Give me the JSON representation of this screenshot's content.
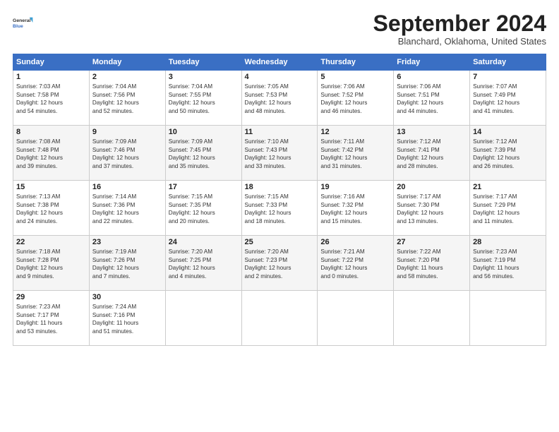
{
  "header": {
    "logo_line1": "General",
    "logo_line2": "Blue",
    "month": "September 2024",
    "location": "Blanchard, Oklahoma, United States"
  },
  "weekdays": [
    "Sunday",
    "Monday",
    "Tuesday",
    "Wednesday",
    "Thursday",
    "Friday",
    "Saturday"
  ],
  "weeks": [
    [
      {
        "day": "1",
        "info": "Sunrise: 7:03 AM\nSunset: 7:58 PM\nDaylight: 12 hours\nand 54 minutes."
      },
      {
        "day": "2",
        "info": "Sunrise: 7:04 AM\nSunset: 7:56 PM\nDaylight: 12 hours\nand 52 minutes."
      },
      {
        "day": "3",
        "info": "Sunrise: 7:04 AM\nSunset: 7:55 PM\nDaylight: 12 hours\nand 50 minutes."
      },
      {
        "day": "4",
        "info": "Sunrise: 7:05 AM\nSunset: 7:53 PM\nDaylight: 12 hours\nand 48 minutes."
      },
      {
        "day": "5",
        "info": "Sunrise: 7:06 AM\nSunset: 7:52 PM\nDaylight: 12 hours\nand 46 minutes."
      },
      {
        "day": "6",
        "info": "Sunrise: 7:06 AM\nSunset: 7:51 PM\nDaylight: 12 hours\nand 44 minutes."
      },
      {
        "day": "7",
        "info": "Sunrise: 7:07 AM\nSunset: 7:49 PM\nDaylight: 12 hours\nand 41 minutes."
      }
    ],
    [
      {
        "day": "8",
        "info": "Sunrise: 7:08 AM\nSunset: 7:48 PM\nDaylight: 12 hours\nand 39 minutes."
      },
      {
        "day": "9",
        "info": "Sunrise: 7:09 AM\nSunset: 7:46 PM\nDaylight: 12 hours\nand 37 minutes."
      },
      {
        "day": "10",
        "info": "Sunrise: 7:09 AM\nSunset: 7:45 PM\nDaylight: 12 hours\nand 35 minutes."
      },
      {
        "day": "11",
        "info": "Sunrise: 7:10 AM\nSunset: 7:43 PM\nDaylight: 12 hours\nand 33 minutes."
      },
      {
        "day": "12",
        "info": "Sunrise: 7:11 AM\nSunset: 7:42 PM\nDaylight: 12 hours\nand 31 minutes."
      },
      {
        "day": "13",
        "info": "Sunrise: 7:12 AM\nSunset: 7:41 PM\nDaylight: 12 hours\nand 28 minutes."
      },
      {
        "day": "14",
        "info": "Sunrise: 7:12 AM\nSunset: 7:39 PM\nDaylight: 12 hours\nand 26 minutes."
      }
    ],
    [
      {
        "day": "15",
        "info": "Sunrise: 7:13 AM\nSunset: 7:38 PM\nDaylight: 12 hours\nand 24 minutes."
      },
      {
        "day": "16",
        "info": "Sunrise: 7:14 AM\nSunset: 7:36 PM\nDaylight: 12 hours\nand 22 minutes."
      },
      {
        "day": "17",
        "info": "Sunrise: 7:15 AM\nSunset: 7:35 PM\nDaylight: 12 hours\nand 20 minutes."
      },
      {
        "day": "18",
        "info": "Sunrise: 7:15 AM\nSunset: 7:33 PM\nDaylight: 12 hours\nand 18 minutes."
      },
      {
        "day": "19",
        "info": "Sunrise: 7:16 AM\nSunset: 7:32 PM\nDaylight: 12 hours\nand 15 minutes."
      },
      {
        "day": "20",
        "info": "Sunrise: 7:17 AM\nSunset: 7:30 PM\nDaylight: 12 hours\nand 13 minutes."
      },
      {
        "day": "21",
        "info": "Sunrise: 7:17 AM\nSunset: 7:29 PM\nDaylight: 12 hours\nand 11 minutes."
      }
    ],
    [
      {
        "day": "22",
        "info": "Sunrise: 7:18 AM\nSunset: 7:28 PM\nDaylight: 12 hours\nand 9 minutes."
      },
      {
        "day": "23",
        "info": "Sunrise: 7:19 AM\nSunset: 7:26 PM\nDaylight: 12 hours\nand 7 minutes."
      },
      {
        "day": "24",
        "info": "Sunrise: 7:20 AM\nSunset: 7:25 PM\nDaylight: 12 hours\nand 4 minutes."
      },
      {
        "day": "25",
        "info": "Sunrise: 7:20 AM\nSunset: 7:23 PM\nDaylight: 12 hours\nand 2 minutes."
      },
      {
        "day": "26",
        "info": "Sunrise: 7:21 AM\nSunset: 7:22 PM\nDaylight: 12 hours\nand 0 minutes."
      },
      {
        "day": "27",
        "info": "Sunrise: 7:22 AM\nSunset: 7:20 PM\nDaylight: 11 hours\nand 58 minutes."
      },
      {
        "day": "28",
        "info": "Sunrise: 7:23 AM\nSunset: 7:19 PM\nDaylight: 11 hours\nand 56 minutes."
      }
    ],
    [
      {
        "day": "29",
        "info": "Sunrise: 7:23 AM\nSunset: 7:17 PM\nDaylight: 11 hours\nand 53 minutes."
      },
      {
        "day": "30",
        "info": "Sunrise: 7:24 AM\nSunset: 7:16 PM\nDaylight: 11 hours\nand 51 minutes."
      },
      {
        "day": "",
        "info": ""
      },
      {
        "day": "",
        "info": ""
      },
      {
        "day": "",
        "info": ""
      },
      {
        "day": "",
        "info": ""
      },
      {
        "day": "",
        "info": ""
      }
    ]
  ]
}
